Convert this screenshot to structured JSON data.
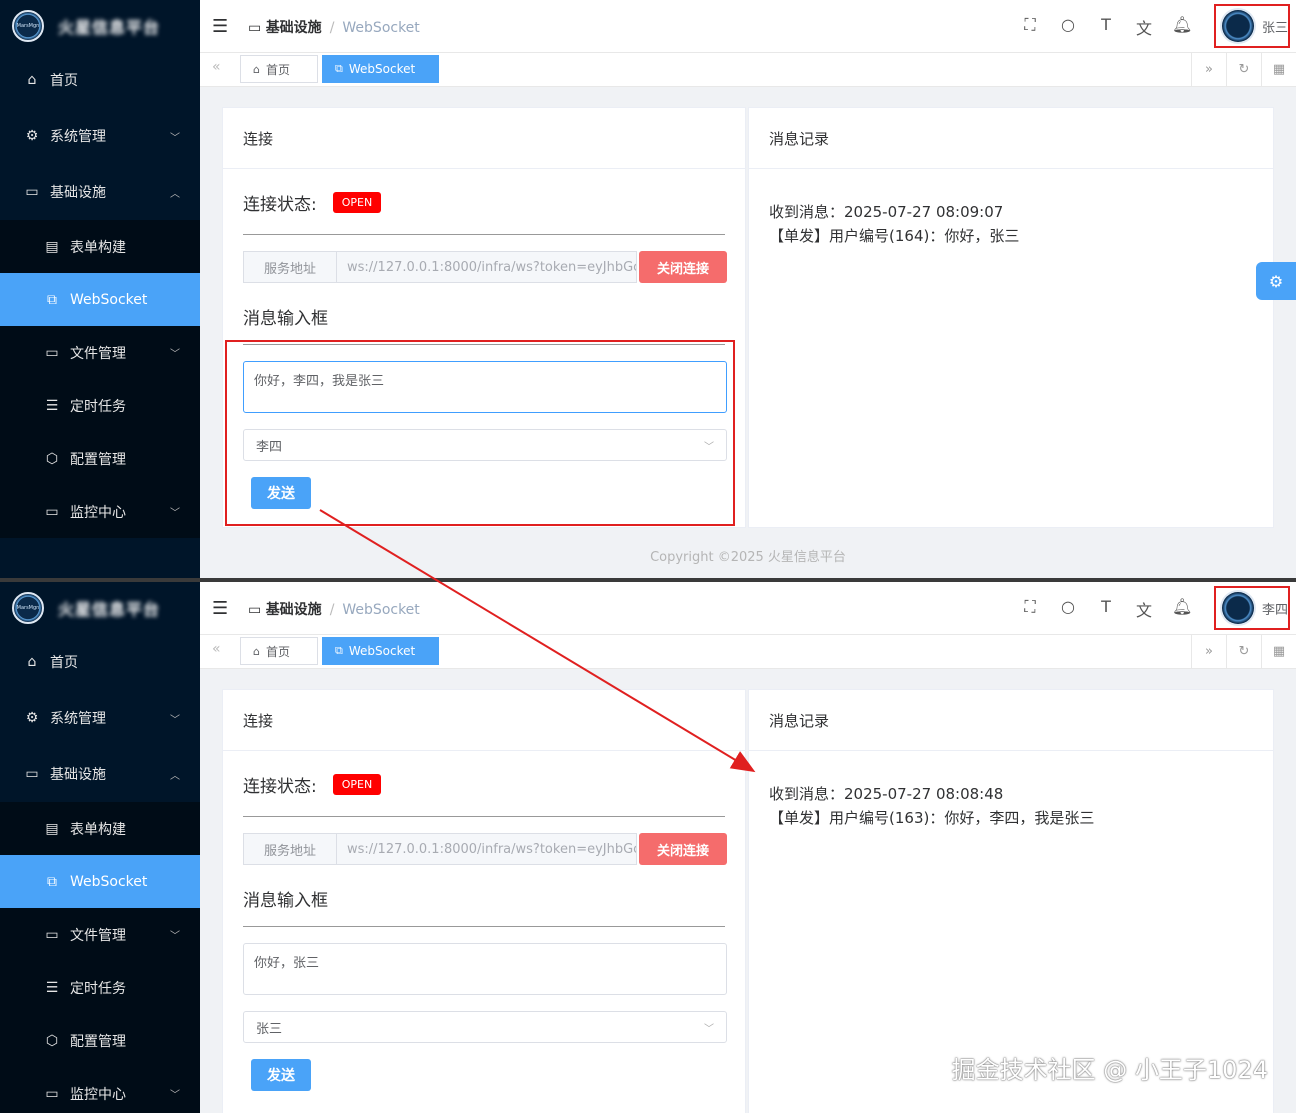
{
  "app": {
    "brand_blurred": "火星信息平台",
    "logo_text": "MarsMgn"
  },
  "sidebar": {
    "items": [
      {
        "label": "首页",
        "icon": "home-icon"
      },
      {
        "label": "系统管理",
        "icon": "gear-icon"
      },
      {
        "label": "基础设施",
        "icon": "monitor-icon"
      },
      {
        "label": "表单构建",
        "icon": "form-icon"
      },
      {
        "label": "WebSocket",
        "icon": "link-icon"
      },
      {
        "label": "文件管理",
        "icon": "folder-icon"
      },
      {
        "label": "定时任务",
        "icon": "list-icon"
      },
      {
        "label": "配置管理",
        "icon": "config-icon"
      },
      {
        "label": "监控中心",
        "icon": "monitor-icon"
      }
    ]
  },
  "breadcrumb": {
    "parent": "基础设施",
    "current": "WebSocket"
  },
  "tabs": {
    "home": "首页",
    "ws": "WebSocket"
  },
  "connection": {
    "title": "连接",
    "status_label": "连接状态:",
    "status_value": "OPEN",
    "addr_prefix": "服务地址",
    "addr_value": "ws://127.0.0.1:8000/infra/ws?token=eyJhbGc",
    "close_button": "关闭连接",
    "input_title": "消息输入框",
    "send_button": "发送"
  },
  "messages": {
    "title": "消息记录"
  },
  "panel1": {
    "user": "张三",
    "input_value": "你好，李四，我是张三",
    "select_value": "李四",
    "log_time": "收到消息：2025-07-27 08:09:07",
    "log_text": "【单发】用户编号(164)：你好，张三"
  },
  "panel2": {
    "user": "李四",
    "input_value": "你好，张三",
    "select_value": "张三",
    "log_time": "收到消息：2025-07-27 08:08:48",
    "log_text": "【单发】用户编号(163)：你好，李四，我是张三"
  },
  "copyright": "Copyright ©2025 火星信息平台",
  "watermark": "掘金技术社区 @ 小王子1024",
  "colors": {
    "sidebar_bg": "#001529",
    "primary": "#4aa3f8",
    "danger": "#f56c6c",
    "highlight": "#e02020"
  }
}
